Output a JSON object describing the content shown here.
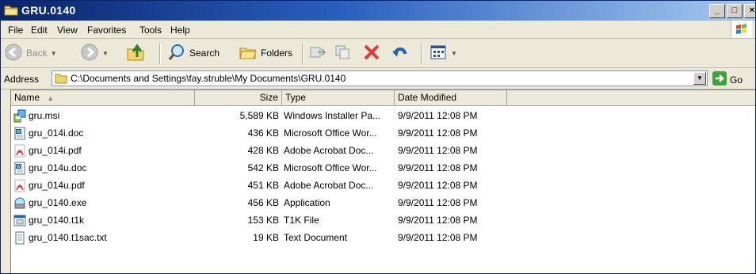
{
  "window": {
    "title": "GRU.0140",
    "controls": {
      "minimize": "_",
      "maximize": "□",
      "close": "×"
    }
  },
  "menu": [
    "File",
    "Edit",
    "View",
    "Favorites",
    "Tools",
    "Help"
  ],
  "toolbar": {
    "back_label": "Back",
    "search_label": "Search",
    "folders_label": "Folders"
  },
  "address": {
    "label": "Address",
    "path": "C:\\Documents and Settings\\fay.struble\\My Documents\\GRU.0140",
    "go_label": "Go"
  },
  "columns": {
    "name": "Name",
    "size": "Size",
    "type": "Type",
    "date": "Date Modified"
  },
  "files": [
    {
      "name": "gru.msi",
      "size": "5,589 KB",
      "type": "Windows Installer Pa...",
      "date": "9/9/2011 12:08 PM",
      "icon": "installer-icon"
    },
    {
      "name": "gru_014i.doc",
      "size": "436 KB",
      "type": "Microsoft Office Wor...",
      "date": "9/9/2011 12:08 PM",
      "icon": "word-doc-icon"
    },
    {
      "name": "gru_014i.pdf",
      "size": "428 KB",
      "type": "Adobe Acrobat Doc...",
      "date": "9/9/2011 12:08 PM",
      "icon": "pdf-icon"
    },
    {
      "name": "gru_014u.doc",
      "size": "542 KB",
      "type": "Microsoft Office Wor...",
      "date": "9/9/2011 12:08 PM",
      "icon": "word-doc-icon"
    },
    {
      "name": "gru_014u.pdf",
      "size": "451 KB",
      "type": "Adobe Acrobat Doc...",
      "date": "9/9/2011 12:08 PM",
      "icon": "pdf-icon"
    },
    {
      "name": "gru_0140.exe",
      "size": "456 KB",
      "type": "Application",
      "date": "9/9/2011 12:08 PM",
      "icon": "application-icon"
    },
    {
      "name": "gru_0140.t1k",
      "size": "153 KB",
      "type": "T1K File",
      "date": "9/9/2011 12:08 PM",
      "icon": "generic-file-icon"
    },
    {
      "name": "gru_0140.t1sac.txt",
      "size": "19 KB",
      "type": "Text Document",
      "date": "9/9/2011 12:08 PM",
      "icon": "text-file-icon"
    }
  ]
}
